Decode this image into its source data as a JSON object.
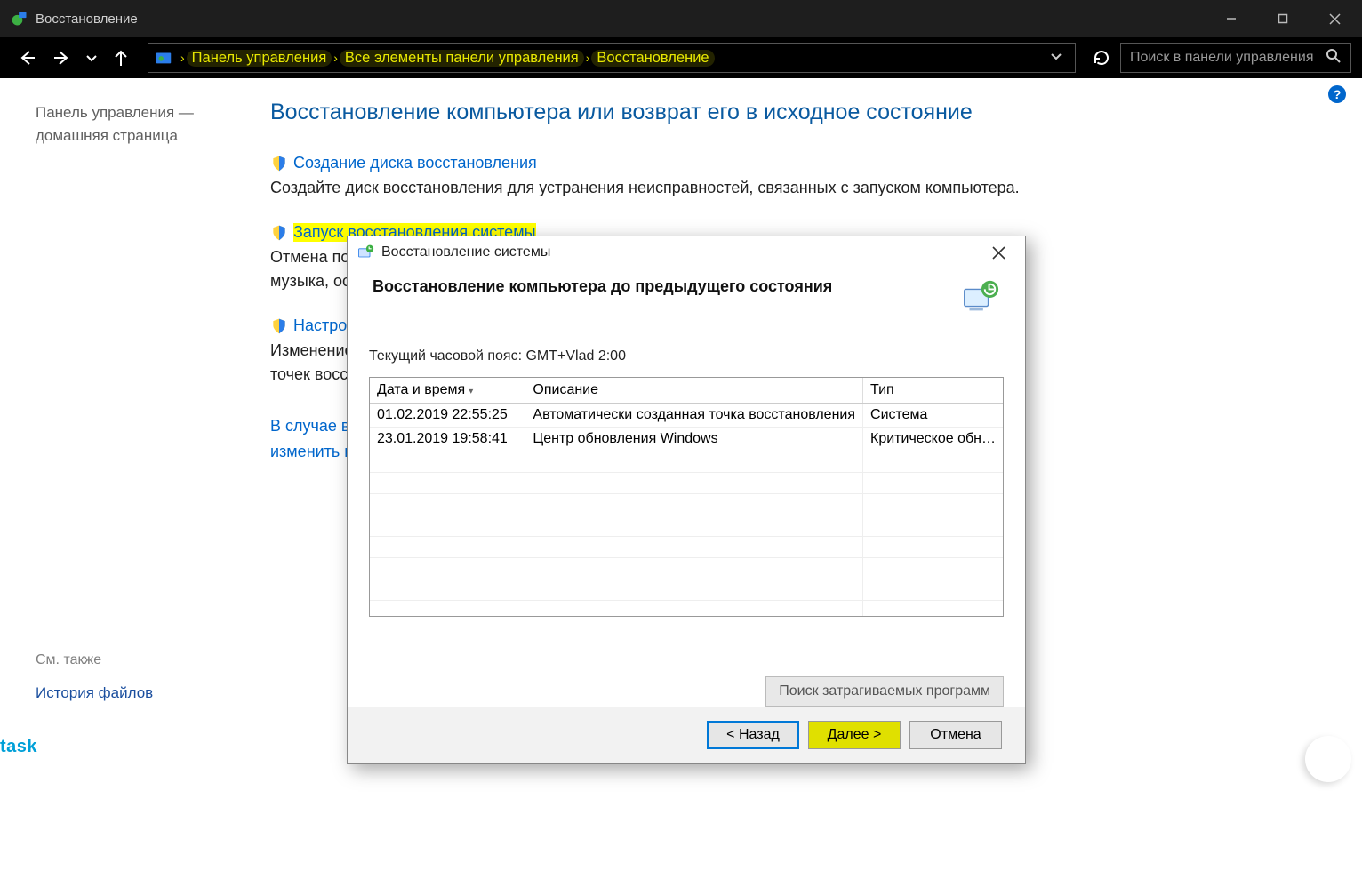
{
  "titlebar": {
    "title": "Восстановление"
  },
  "breadcrumb": {
    "items": [
      "Панель управления",
      "Все элементы панели управления",
      "Восстановление"
    ]
  },
  "search": {
    "placeholder": "Поиск в панели управления"
  },
  "sidebar": {
    "home": "Панель управления — домашняя страница",
    "see_also_heading": "См. также",
    "history_link": "История файлов"
  },
  "main": {
    "heading": "Восстановление компьютера или возврат его в исходное состояние",
    "opt1": {
      "link": "Создание диска восстановления",
      "desc": "Создайте диск восстановления для устранения неисправностей, связанных с запуском компьютера."
    },
    "opt2": {
      "link": "Запуск восстановления системы",
      "desc_a": "Отмена по",
      "desc_b": "музыка, ост"
    },
    "opt3": {
      "link": "Настрой",
      "desc_a": "Изменение",
      "desc_b": "точек восст"
    },
    "trouble_a": "В случае во",
    "trouble_b": "изменить их"
  },
  "dialog": {
    "title": "Восстановление системы",
    "header": "Восстановление компьютера до предыдущего состояния",
    "timezone": "Текущий часовой пояс: GMT+Vlad 2:00",
    "columns": {
      "c1": "Дата и время",
      "c2": "Описание",
      "c3": "Тип"
    },
    "rows": [
      {
        "c1": "01.02.2019 22:55:25",
        "c2": "Автоматически созданная точка восстановления",
        "c3": "Система"
      },
      {
        "c1": "23.01.2019 19:58:41",
        "c2": "Центр обновления Windows",
        "c3": "Критическое обн…"
      }
    ],
    "scan_btn": "Поиск затрагиваемых программ",
    "back_btn": "< Назад",
    "next_btn": "Далее >",
    "cancel_btn": "Отмена"
  },
  "misc": {
    "task": "task",
    "help": "?"
  }
}
